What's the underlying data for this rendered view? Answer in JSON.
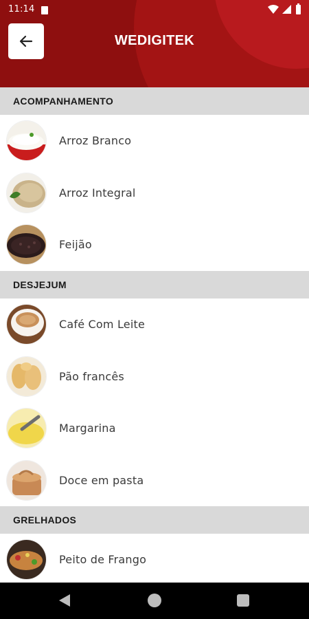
{
  "status_bar": {
    "time": "11:14"
  },
  "app_bar": {
    "title": "WEDIGITEK",
    "back_icon": "arrow-left-icon"
  },
  "colors": {
    "header_primary": "#8e0f0f",
    "header_accent": "#b81a1e",
    "section_bg": "#d9d9d9"
  },
  "sections": [
    {
      "title": "ACOMPANHAMENTO",
      "items": [
        {
          "label": "Arroz Branco",
          "icon": "white-rice-thumbnail"
        },
        {
          "label": "Arroz Integral",
          "icon": "brown-rice-thumbnail"
        },
        {
          "label": "Feijão",
          "icon": "black-beans-thumbnail"
        }
      ]
    },
    {
      "title": "DESJEJUM",
      "items": [
        {
          "label": "Café Com Leite",
          "icon": "coffee-thumbnail"
        },
        {
          "label": "Pão francês",
          "icon": "bread-thumbnail"
        },
        {
          "label": "Margarina",
          "icon": "margarine-thumbnail"
        },
        {
          "label": "Doce em pasta",
          "icon": "sweet-paste-thumbnail"
        }
      ]
    },
    {
      "title": "GRELHADOS",
      "items": [
        {
          "label": "Peito de Frango",
          "icon": "chicken-breast-thumbnail"
        }
      ]
    }
  ]
}
